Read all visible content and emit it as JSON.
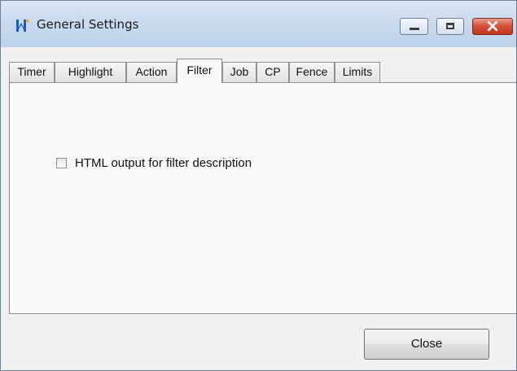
{
  "window": {
    "title": "General Settings",
    "app_icon": "app-logo-icon",
    "controls": {
      "minimize_icon": "minimize-icon",
      "maximize_icon": "maximize-icon",
      "close_icon": "close-icon"
    }
  },
  "tabs": [
    {
      "label": "Timer",
      "active": false
    },
    {
      "label": "Highlight",
      "active": false
    },
    {
      "label": "Action",
      "active": false
    },
    {
      "label": "Filter",
      "active": true
    },
    {
      "label": "Job",
      "active": false
    },
    {
      "label": "CP",
      "active": false
    },
    {
      "label": "Fence",
      "active": false
    },
    {
      "label": "Limits",
      "active": false
    }
  ],
  "filter_panel": {
    "html_output_checkbox": {
      "label": "HTML output for filter description",
      "checked": false
    }
  },
  "footer": {
    "close_label": "Close"
  },
  "colors": {
    "titlebar": "#c9dbee",
    "close_button": "#c2321f",
    "dialog_background": "#f0f0f0"
  }
}
